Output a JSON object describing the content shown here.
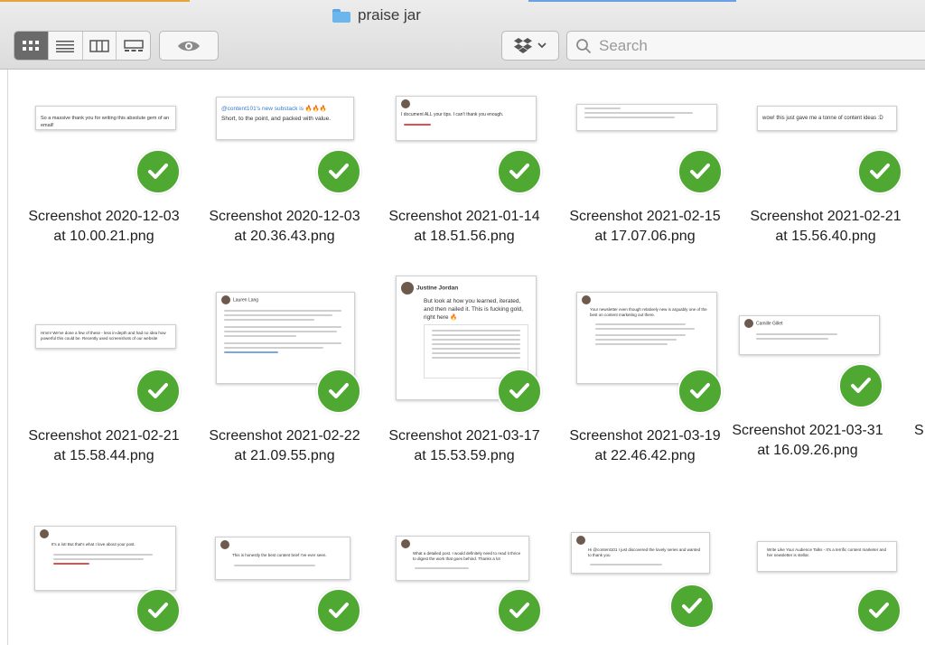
{
  "window": {
    "title": "praise jar"
  },
  "toolbar": {
    "view_modes": [
      {
        "name": "icon-view",
        "active": true
      },
      {
        "name": "list-view",
        "active": false
      },
      {
        "name": "column-view",
        "active": false
      },
      {
        "name": "gallery-view",
        "active": false
      }
    ],
    "quick_look_icon": "eye-icon",
    "dropbox_icon": "dropbox-icon",
    "search_placeholder": "Search"
  },
  "files": [
    {
      "line1": "Screenshot 2020-12-03",
      "line2": "at 10.00.21.png",
      "snippet": "So a massive thank you for writing this absolute gem of an email!"
    },
    {
      "line1": "Screenshot 2020-12-03",
      "line2": "at 20.36.43.png",
      "snippet": "@content101's new substack is 🔥🔥🔥",
      "snippet2": "Short, to the point, and packed with value."
    },
    {
      "line1": "Screenshot 2021-01-14",
      "line2": "at 18.51.56.png",
      "snippet": "I document ALL your tips. I can't thank you enough."
    },
    {
      "line1": "Screenshot 2021-02-15",
      "line2": "at 17.07.06.png",
      "snippet": ""
    },
    {
      "line1": "Screenshot 2021-02-21",
      "line2": "at 15.56.40.png",
      "snippet": "wow! this just gave me a tonne of content ideas :D"
    },
    {
      "line1": "Screenshot 2021-02-21",
      "line2": "at 15.58.44.png",
      "snippet": "Hmm! We've done a few of these - less in-depth and had no idea how powerful this could be. Recently used screenshots of our website"
    },
    {
      "line1": "Screenshot 2021-02-22",
      "line2": "at 21.09.55.png",
      "snippet": "Lauren Lang"
    },
    {
      "line1": "Screenshot 2021-03-17",
      "line2": "at 15.53.59.png",
      "snippet": "Justine Jordan",
      "snippet2": "But look at how you learned, iterated, and then nailed it. This is fucking gold, right here 🔥"
    },
    {
      "line1": "Screenshot 2021-03-19",
      "line2": "at 22.46.42.png",
      "snippet": "Your newsletter even though relatively new is arguably one of the best on content marketing out there."
    },
    {
      "line1": "Screenshot 2021-03-31",
      "line2": "at 16.09.26.png",
      "snippet": "Camille Gillet"
    },
    {
      "line1": "",
      "line2": "",
      "snippet": "It's a lot! But that's what I love about your post."
    },
    {
      "line1": "",
      "line2": "",
      "snippet": "This is honestly the best content brief I've ever seen."
    },
    {
      "line1": "",
      "line2": "",
      "snippet": "What a detailed post. I would definitely need to read it thrice to digest the work that goes behind. Thanks a lot"
    },
    {
      "line1": "",
      "line2": "",
      "snippet": "Hi @content101 I just discovered the lovely series and wanted to thank you"
    },
    {
      "line1": "",
      "line2": "",
      "snippet": "Write Like Your Audience Talks - It's a terrific content marketer and her newsletter is stellar."
    }
  ],
  "partial_right": {
    "line1": "S"
  }
}
